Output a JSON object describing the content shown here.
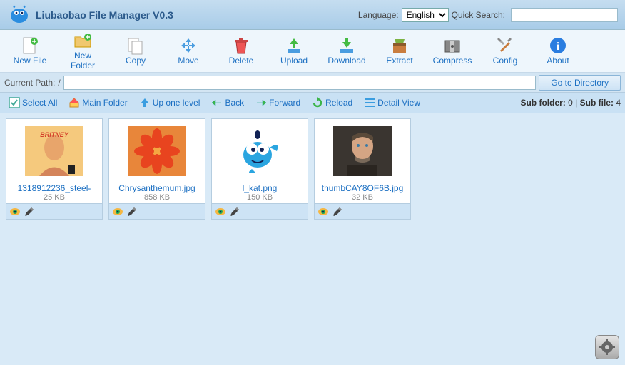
{
  "header": {
    "title": "Liubaobao File Manager V0.3",
    "language_label": "Language:",
    "language_value": "English",
    "quick_search_label": "Quick Search:",
    "quick_search_value": ""
  },
  "toolbar": [
    {
      "id": "new-file",
      "label": "New File",
      "icon": "new-file"
    },
    {
      "id": "new-folder",
      "label": "New\nFolder",
      "icon": "new-folder"
    },
    {
      "id": "copy",
      "label": "Copy",
      "icon": "copy"
    },
    {
      "id": "move",
      "label": "Move",
      "icon": "move"
    },
    {
      "id": "delete",
      "label": "Delete",
      "icon": "delete"
    },
    {
      "id": "upload",
      "label": "Upload",
      "icon": "upload"
    },
    {
      "id": "download",
      "label": "Download",
      "icon": "download"
    },
    {
      "id": "extract",
      "label": "Extract",
      "icon": "extract"
    },
    {
      "id": "compress",
      "label": "Compress",
      "icon": "compress"
    },
    {
      "id": "config",
      "label": "Config",
      "icon": "config"
    },
    {
      "id": "about",
      "label": "About",
      "icon": "about"
    }
  ],
  "pathbar": {
    "label": "Current Path:",
    "value": "/",
    "go_label": "Go to Directory"
  },
  "actions": {
    "select_all": "Select All",
    "main_folder": "Main Folder",
    "up_one_level": "Up one level",
    "back": "Back",
    "forward": "Forward",
    "reload": "Reload",
    "detail_view": "Detail View"
  },
  "stats": {
    "subfolder_label": "Sub folder:",
    "subfolder_count": "0",
    "subfile_label": "Sub file:",
    "subfile_count": "4"
  },
  "files": [
    {
      "name": "1318912236_steel-",
      "size": "25 KB",
      "thumb": "photo-person"
    },
    {
      "name": "Chrysanthemum.jpg",
      "size": "858 KB",
      "thumb": "flower"
    },
    {
      "name": "l_kat.png",
      "size": "150 KB",
      "thumb": "genie"
    },
    {
      "name": "thumbCAY8OF6B.jpg",
      "size": "32 KB",
      "thumb": "man"
    }
  ]
}
